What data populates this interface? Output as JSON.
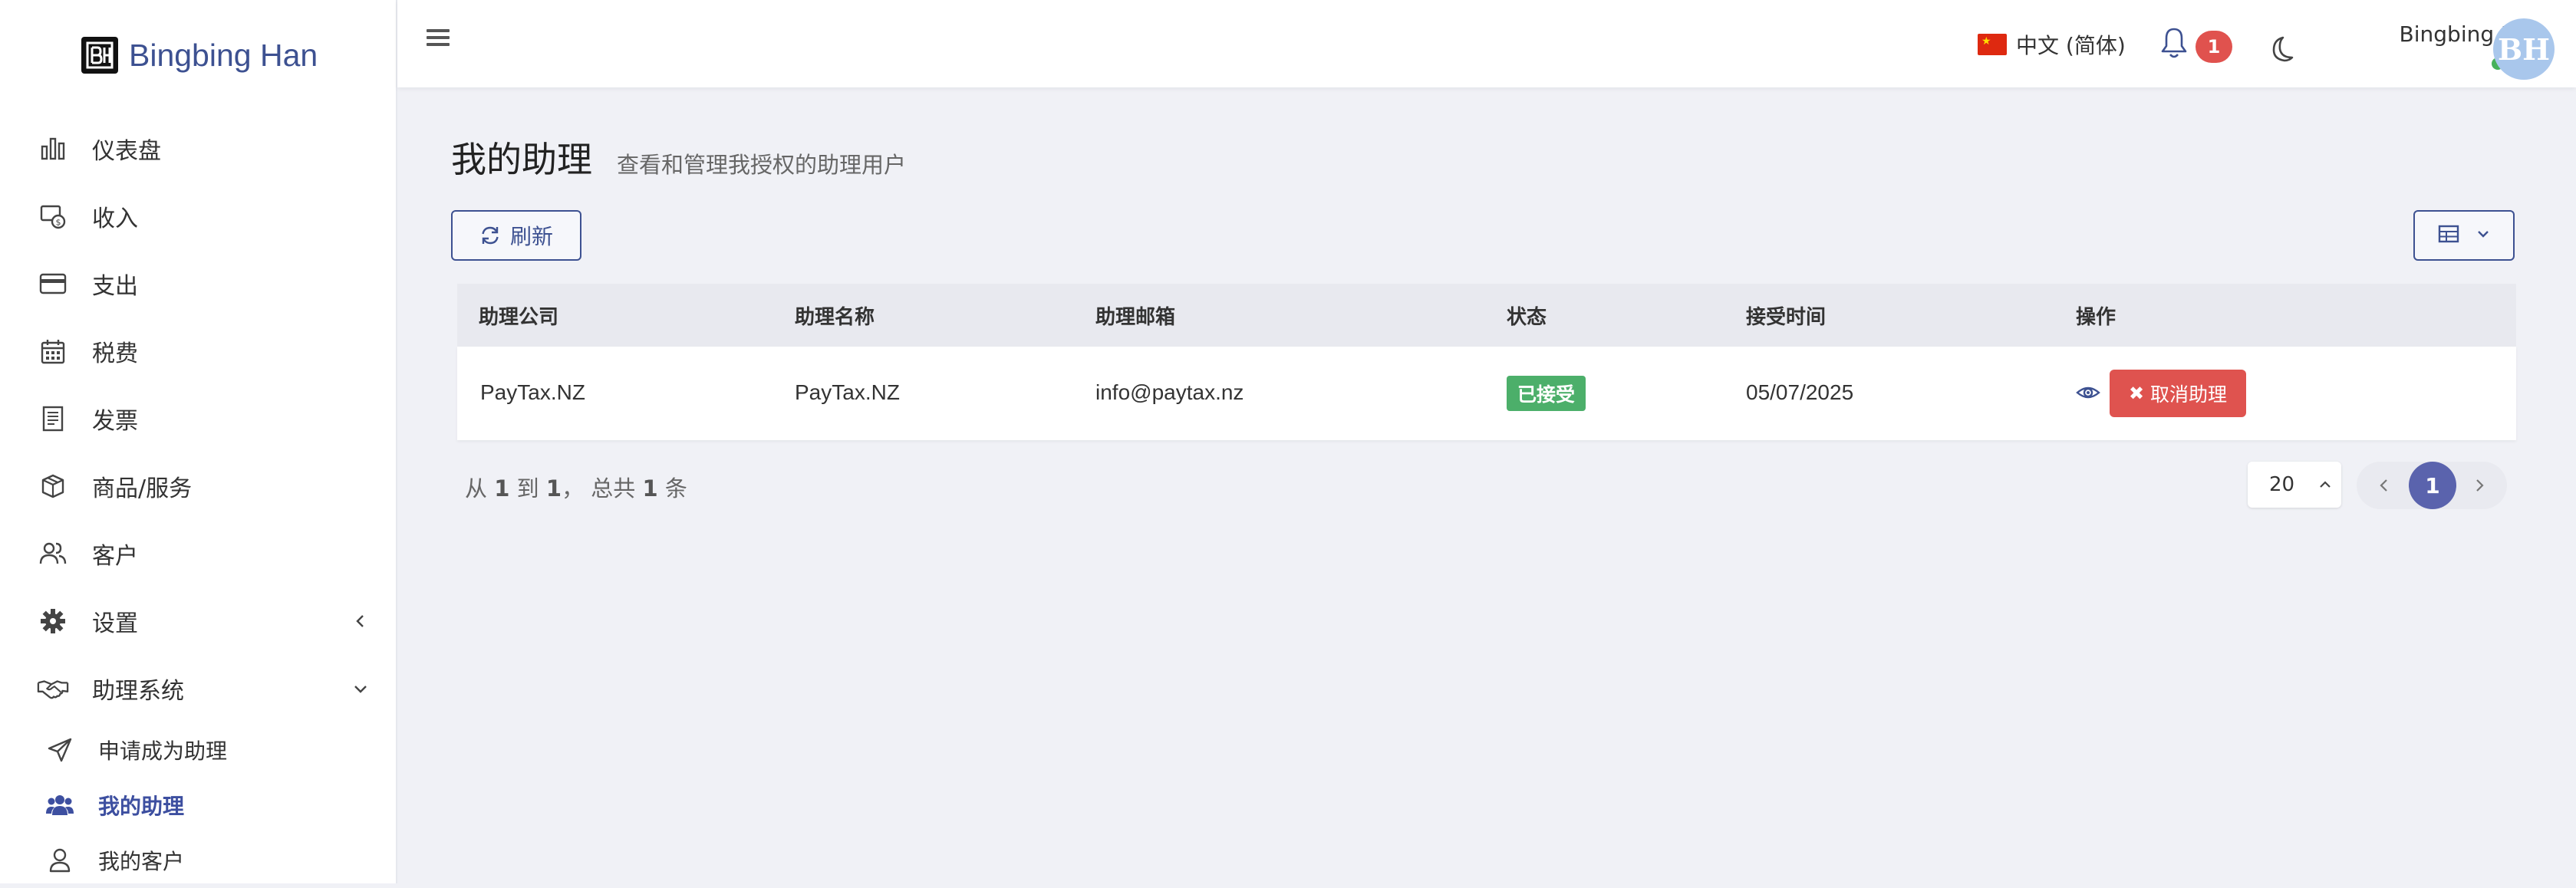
{
  "brand": {
    "logo_text": "B|-|",
    "name": "Bingbing Han"
  },
  "sidebar": {
    "items": [
      {
        "label": "仪表盘",
        "icon": "bar-chart-icon"
      },
      {
        "label": "收入",
        "icon": "income-icon"
      },
      {
        "label": "支出",
        "icon": "credit-card-icon"
      },
      {
        "label": "税费",
        "icon": "calendar-icon"
      },
      {
        "label": "发票",
        "icon": "invoice-icon"
      },
      {
        "label": "商品/服务",
        "icon": "box-icon"
      },
      {
        "label": "客户",
        "icon": "users-icon"
      },
      {
        "label": "设置",
        "icon": "gear-icon"
      },
      {
        "label": "助理系统",
        "icon": "handshake-icon"
      }
    ],
    "sub_items": [
      {
        "label": "申请成为助理",
        "icon": "paper-plane-icon"
      },
      {
        "label": "我的助理",
        "icon": "user-group-icon",
        "active": true
      },
      {
        "label": "我的客户",
        "icon": "user-icon"
      }
    ]
  },
  "topbar": {
    "language": "中文 (简体)",
    "notification_count": "1",
    "user_name": "Bingbing Han",
    "user_status": "在线",
    "avatar_initials": "BH"
  },
  "page": {
    "title": "我的助理",
    "subtitle": "查看和管理我授权的助理用户",
    "refresh_label": "刷新"
  },
  "table": {
    "headers": [
      "助理公司",
      "助理名称",
      "助理邮箱",
      "状态",
      "接受时间",
      "操作"
    ],
    "rows": [
      {
        "company": "PayTax.NZ",
        "name": "PayTax.NZ",
        "email": "info@paytax.nz",
        "status": "已接受",
        "accepted_time": "05/07/2025",
        "action_label": "取消助理"
      }
    ]
  },
  "pagination": {
    "info_prefix": "从",
    "from": "1",
    "info_to": "到",
    "to": "1",
    "info_total": "， 总共",
    "total": "1",
    "info_suffix": "条",
    "page_size": "20",
    "current_page": "1"
  },
  "colors": {
    "primary": "#3d5191",
    "danger": "#df534f",
    "success": "#4caf6a",
    "page_bg": "#f0f1f6"
  }
}
